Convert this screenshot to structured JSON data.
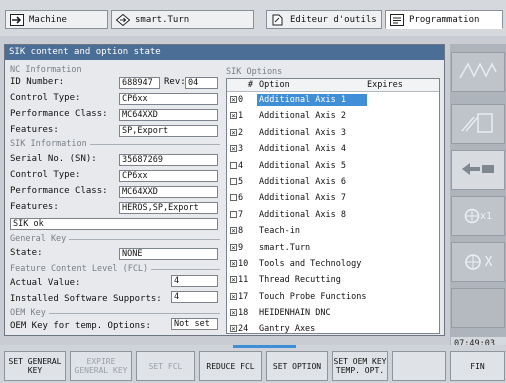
{
  "tabs": [
    {
      "label": "Machine",
      "icon": "arrow-right-icon"
    },
    {
      "label": "smart.Turn",
      "icon": "diamond-arrow-icon"
    },
    {
      "label": "Editeur d'outils",
      "icon": "tool-editor-icon"
    },
    {
      "label": "Programmation",
      "icon": "program-icon"
    }
  ],
  "window": {
    "title": "SIK content and option state",
    "nc_info": {
      "group": "NC Information",
      "id_label": "ID Number:",
      "id_value": "688947",
      "rev_label": "Rev:",
      "rev_value": "04",
      "control_label": "Control Type:",
      "control_value": "CP6xx",
      "perf_label": "Performance Class:",
      "perf_value": "MC64XXD",
      "features_label": "Features:",
      "features_value": "SP,Export"
    },
    "sik_info": {
      "group": "SIK Information",
      "serial_label": "Serial No. (SN):",
      "serial_value": "35687269",
      "control_label": "Control Type:",
      "control_value": "CP6xx",
      "perf_label": "Performance Class:",
      "perf_value": "MC64XXD",
      "features_label": "Features:",
      "features_value": "HEROS,SP,Export",
      "status_value": "SIK ok"
    },
    "general_key": {
      "group": "General Key",
      "state_label": "State:",
      "state_value": "NONE"
    },
    "fcl": {
      "group": "Feature Content Level (FCL)",
      "actual_label": "Actual Value:",
      "actual_value": "4",
      "installed_label": "Installed Software Supports:",
      "installed_value": "4"
    },
    "oem": {
      "group": "OEM Key",
      "temp_label": "OEM Key for temp. Options:",
      "temp_value": "Not set"
    },
    "sik_options": {
      "group": "SIK Options",
      "headers": [
        "#",
        "Option",
        "Expires"
      ],
      "rows": [
        {
          "checked": true,
          "num": "0",
          "name": "Additional Axis 1",
          "selected": true
        },
        {
          "checked": true,
          "num": "1",
          "name": "Additional Axis 2"
        },
        {
          "checked": true,
          "num": "2",
          "name": "Additional Axis 3"
        },
        {
          "checked": true,
          "num": "3",
          "name": "Additional Axis 4"
        },
        {
          "checked": false,
          "num": "4",
          "name": "Additional Axis 5"
        },
        {
          "checked": false,
          "num": "5",
          "name": "Additional Axis 6"
        },
        {
          "checked": false,
          "num": "6",
          "name": "Additional Axis 7"
        },
        {
          "checked": false,
          "num": "7",
          "name": "Additional Axis 8"
        },
        {
          "checked": true,
          "num": "8",
          "name": "Teach-in"
        },
        {
          "checked": true,
          "num": "9",
          "name": "smart.Turn"
        },
        {
          "checked": true,
          "num": "10",
          "name": "Tools and Technology"
        },
        {
          "checked": true,
          "num": "11",
          "name": "Thread Recutting"
        },
        {
          "checked": true,
          "num": "17",
          "name": "Touch Probe Functions"
        },
        {
          "checked": true,
          "num": "18",
          "name": "HEIDENHAIN DNC"
        },
        {
          "checked": true,
          "num": "24",
          "name": "Gantry Axes"
        }
      ]
    }
  },
  "side_buttons": [
    {
      "icon": "waveform-icon"
    },
    {
      "icon": "mirror-tool-icon"
    },
    {
      "icon": "tool-transfer-icon"
    },
    {
      "icon": "handwheel-x1-icon",
      "label": "x1"
    },
    {
      "icon": "handwheel-x-icon",
      "label": "X"
    },
    {
      "icon": "blank-icon"
    }
  ],
  "clock": "07:49:03",
  "softkeys": [
    {
      "label": "SET GENERAL\nKEY",
      "enabled": true
    },
    {
      "label": "EXPIRE\nGENERAL KEY",
      "enabled": false
    },
    {
      "label": "SET FCL",
      "enabled": false
    },
    {
      "label": "REDUCE FCL",
      "enabled": true
    },
    {
      "label": "SET OPTION",
      "enabled": true
    },
    {
      "label": "SET OEM KEY\nTEMP. OPT.",
      "enabled": true
    },
    {
      "label": "",
      "enabled": false
    },
    {
      "label": "FIN",
      "enabled": true
    }
  ],
  "colors": {
    "accent": "#3e8ed8",
    "titlebar": "#4a6e96"
  }
}
